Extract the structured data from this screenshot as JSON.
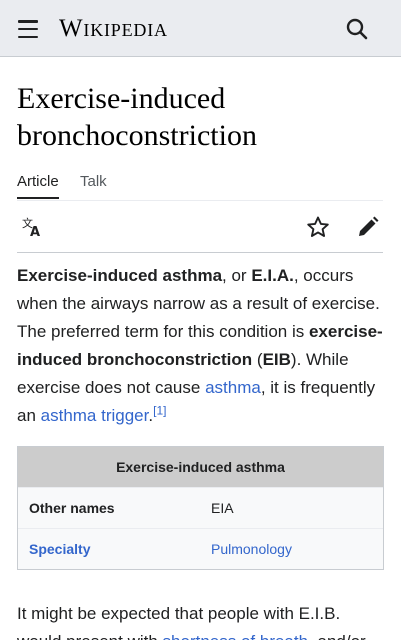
{
  "header": {
    "wordmark": "Wikipedia",
    "menu_icon": "hamburger-menu-icon",
    "search_icon": "search-icon",
    "background": "#eaecf0"
  },
  "article": {
    "title": "Exercise-induced bronchoconstriction",
    "tabs": [
      {
        "label": "Article",
        "active": true
      },
      {
        "label": "Talk",
        "active": false
      }
    ],
    "toolbar": {
      "language_icon": "language-icon",
      "watch_icon": "star-icon",
      "edit_icon": "pencil-icon"
    },
    "lead": {
      "t1": "Exercise-induced asthma",
      "t2": ", or ",
      "t3": "E.I.A.",
      "t4": ", occurs when the airways narrow as a result of exercise. The preferred term for this condition is ",
      "t5": "exercise-induced bronchoconstriction",
      "t6": " (",
      "t7": "EIB",
      "t8": "). While exercise does not cause ",
      "link_asthma": "asthma",
      "t9": ", it is frequently an ",
      "link_trigger": "asthma trigger",
      "t10": ".",
      "ref": "[1]"
    },
    "infobox": {
      "title": "Exercise-induced asthma",
      "rows": [
        {
          "label": "Other names",
          "value": "EIA"
        },
        {
          "label": "Specialty",
          "value": "Pulmonology"
        }
      ]
    },
    "para2": {
      "t1": "It might be expected that people with E.I.B. would present with ",
      "link_sob": "shortness of breath",
      "t2": ", and/or"
    }
  },
  "colors": {
    "link": "#3366cc",
    "text": "#202122",
    "infobox_header": "#cccccc"
  }
}
